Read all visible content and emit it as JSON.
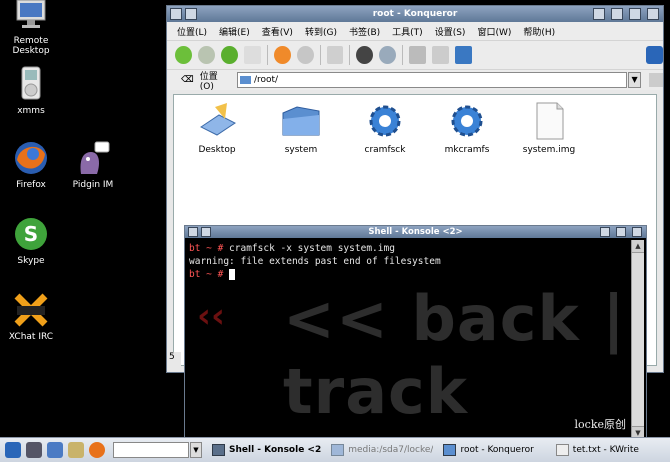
{
  "desktop": {
    "icons": [
      {
        "label": "Remote\nDesktop"
      },
      {
        "label": "xmms"
      },
      {
        "label": "Firefox"
      },
      {
        "label": "Pidgin IM"
      },
      {
        "label": "Skype"
      },
      {
        "label": "XChat IRC"
      }
    ]
  },
  "konqueror": {
    "title": "root - Konqueror",
    "menu": [
      "位置(L)",
      "编辑(E)",
      "查看(V)",
      "转到(G)",
      "书签(B)",
      "工具(T)",
      "设置(S)",
      "窗口(W)",
      "帮助(H)"
    ],
    "location_label": "位置(O)",
    "location_value": "/root/",
    "files": [
      {
        "label": "Desktop"
      },
      {
        "label": "system"
      },
      {
        "label": "cramfsck"
      },
      {
        "label": "mkcramfs"
      },
      {
        "label": "system.img"
      }
    ],
    "status_stub": "5"
  },
  "konsole": {
    "title": "Shell - Konsole <2>",
    "lines": [
      {
        "prompt": "bt ~ # ",
        "text": "cramfsck -x system system.img"
      },
      {
        "prompt": "",
        "text": "warning: file extends past end of filesystem"
      },
      {
        "prompt": "bt ~ # ",
        "text": ""
      }
    ],
    "watermark": "<< back | track",
    "signature": "locke原创"
  },
  "taskbar": {
    "tasks": [
      {
        "label": "Shell - Konsole <2"
      },
      {
        "label": "media:/sda7/locke/"
      },
      {
        "label": "root - Konqueror"
      },
      {
        "label": "tet.txt - KWrite"
      }
    ]
  },
  "colors": {
    "titlebar": "#5f7897",
    "prompt": "#ff5555",
    "taskbar": "#cdd5e0"
  }
}
